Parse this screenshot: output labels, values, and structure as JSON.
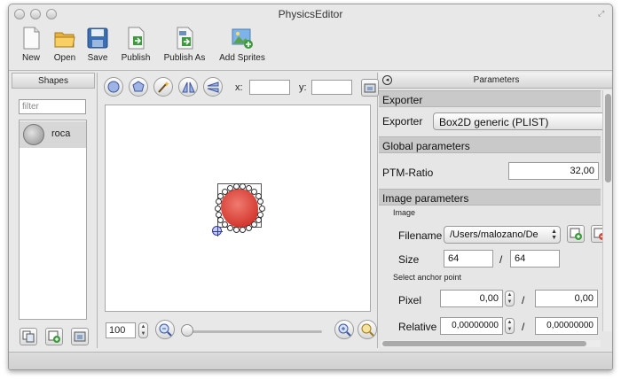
{
  "window": {
    "title": "PhysicsEditor"
  },
  "toolbar": {
    "new_label": "New",
    "open_label": "Open",
    "save_label": "Save",
    "publish_label": "Publish",
    "publish_as_label": "Publish As",
    "add_sprites_label": "Add Sprites"
  },
  "shapes": {
    "header": "Shapes",
    "filter_placeholder": "filter",
    "items": [
      {
        "label": "roca"
      }
    ]
  },
  "canvas": {
    "x_label": "x:",
    "y_label": "y:",
    "x_value": "",
    "y_value": "",
    "zoom_value": "100"
  },
  "parameters": {
    "header": "Parameters",
    "exporter_section": "Exporter",
    "exporter_label": "Exporter",
    "exporter_value": "Box2D generic (PLIST)",
    "global_section": "Global parameters",
    "ptm_label": "PTM-Ratio",
    "ptm_value": "32,00",
    "image_section": "Image parameters",
    "image_sub": "Image",
    "filename_label": "Filename",
    "filename_value": "/Users/malozano/De",
    "size_label": "Size",
    "size_w": "64",
    "size_sep": "/",
    "size_h": "64",
    "anchor_sub": "Select anchor point",
    "pixel_label": "Pixel",
    "pixel_x": "0,00",
    "pixel_y": "0,00",
    "relative_label": "Relative",
    "relative_x": "0,00000000",
    "relative_y": "0,00000000"
  },
  "colors": {
    "sprite_red": "#d43a30",
    "anchor_blue": "#2e3ba8",
    "selection_gray": "#d7d7d7"
  }
}
